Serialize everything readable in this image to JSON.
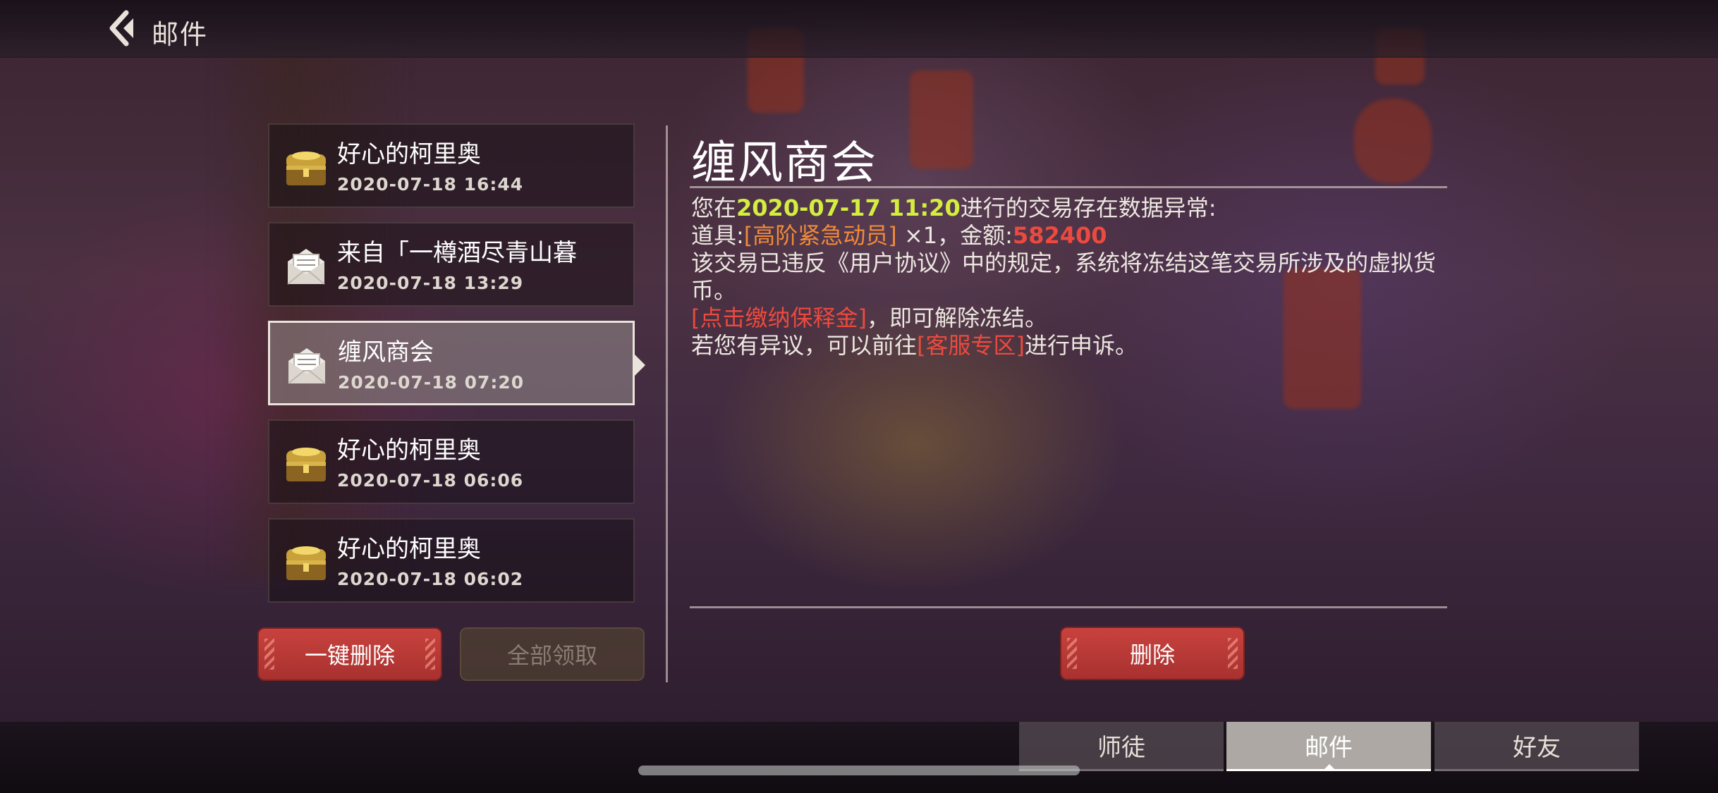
{
  "header": {
    "title": "邮件",
    "back_icon": "back-arrow-icon"
  },
  "mail_list": [
    {
      "sender": "好心的柯里奥",
      "date": "2020-07-18 16:44",
      "icon": "treasure-chest-icon",
      "selected": false
    },
    {
      "sender": "来自「一樽酒尽青山暮",
      "date": "2020-07-18 13:29",
      "icon": "open-envelope-icon",
      "selected": false
    },
    {
      "sender": "缠风商会",
      "date": "2020-07-18 07:20",
      "icon": "open-envelope-icon",
      "selected": true
    },
    {
      "sender": "好心的柯里奥",
      "date": "2020-07-18 06:06",
      "icon": "treasure-chest-icon",
      "selected": false
    },
    {
      "sender": "好心的柯里奥",
      "date": "2020-07-18 06:02",
      "icon": "treasure-chest-icon",
      "selected": false
    }
  ],
  "list_actions": {
    "delete_all_label": "一键删除",
    "claim_all_label": "全部领取"
  },
  "detail": {
    "title": "缠风商会",
    "line1_prefix": "您在",
    "line1_datetime": "2020-07-17  11:20",
    "line1_suffix": "进行的交易存在数据异常:",
    "line2_prefix": "道具:",
    "line2_item": "[高阶紧急动员]",
    "line2_middle": " ×1，金额:",
    "line2_amount": "582400",
    "line3": "该交易已违反《用户协议》中的规定，系统将冻结这笔交易所涉及的虚拟货币。",
    "line4_link": "[点击缴纳保释金]",
    "line4_suffix": "，即可解除冻结。",
    "line5_prefix": "若您有异议，可以前往",
    "line5_link": "[客服专区]",
    "line5_suffix": "进行申诉。",
    "delete_label": "删除"
  },
  "tabs": [
    {
      "label": "师徒",
      "active": false
    },
    {
      "label": "邮件",
      "active": true
    },
    {
      "label": "好友",
      "active": false
    }
  ],
  "colors": {
    "accent_red": "#c8423e",
    "highlight_green": "#d4ee3e",
    "highlight_orange": "#f08a3a",
    "highlight_red": "#ec4a3e"
  }
}
